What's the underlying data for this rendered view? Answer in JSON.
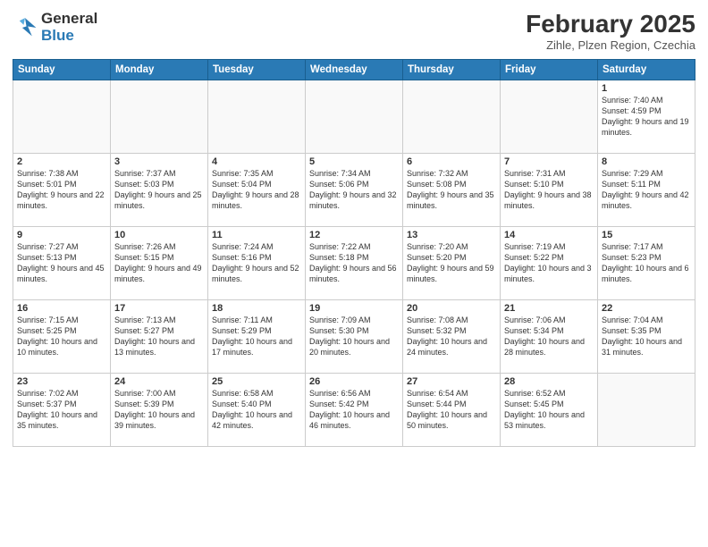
{
  "logo": {
    "general": "General",
    "blue": "Blue"
  },
  "title": "February 2025",
  "location": "Zihle, Plzen Region, Czechia",
  "days_of_week": [
    "Sunday",
    "Monday",
    "Tuesday",
    "Wednesday",
    "Thursday",
    "Friday",
    "Saturday"
  ],
  "weeks": [
    [
      {
        "num": "",
        "info": ""
      },
      {
        "num": "",
        "info": ""
      },
      {
        "num": "",
        "info": ""
      },
      {
        "num": "",
        "info": ""
      },
      {
        "num": "",
        "info": ""
      },
      {
        "num": "",
        "info": ""
      },
      {
        "num": "1",
        "info": "Sunrise: 7:40 AM\nSunset: 4:59 PM\nDaylight: 9 hours and 19 minutes."
      }
    ],
    [
      {
        "num": "2",
        "info": "Sunrise: 7:38 AM\nSunset: 5:01 PM\nDaylight: 9 hours and 22 minutes."
      },
      {
        "num": "3",
        "info": "Sunrise: 7:37 AM\nSunset: 5:03 PM\nDaylight: 9 hours and 25 minutes."
      },
      {
        "num": "4",
        "info": "Sunrise: 7:35 AM\nSunset: 5:04 PM\nDaylight: 9 hours and 28 minutes."
      },
      {
        "num": "5",
        "info": "Sunrise: 7:34 AM\nSunset: 5:06 PM\nDaylight: 9 hours and 32 minutes."
      },
      {
        "num": "6",
        "info": "Sunrise: 7:32 AM\nSunset: 5:08 PM\nDaylight: 9 hours and 35 minutes."
      },
      {
        "num": "7",
        "info": "Sunrise: 7:31 AM\nSunset: 5:10 PM\nDaylight: 9 hours and 38 minutes."
      },
      {
        "num": "8",
        "info": "Sunrise: 7:29 AM\nSunset: 5:11 PM\nDaylight: 9 hours and 42 minutes."
      }
    ],
    [
      {
        "num": "9",
        "info": "Sunrise: 7:27 AM\nSunset: 5:13 PM\nDaylight: 9 hours and 45 minutes."
      },
      {
        "num": "10",
        "info": "Sunrise: 7:26 AM\nSunset: 5:15 PM\nDaylight: 9 hours and 49 minutes."
      },
      {
        "num": "11",
        "info": "Sunrise: 7:24 AM\nSunset: 5:16 PM\nDaylight: 9 hours and 52 minutes."
      },
      {
        "num": "12",
        "info": "Sunrise: 7:22 AM\nSunset: 5:18 PM\nDaylight: 9 hours and 56 minutes."
      },
      {
        "num": "13",
        "info": "Sunrise: 7:20 AM\nSunset: 5:20 PM\nDaylight: 9 hours and 59 minutes."
      },
      {
        "num": "14",
        "info": "Sunrise: 7:19 AM\nSunset: 5:22 PM\nDaylight: 10 hours and 3 minutes."
      },
      {
        "num": "15",
        "info": "Sunrise: 7:17 AM\nSunset: 5:23 PM\nDaylight: 10 hours and 6 minutes."
      }
    ],
    [
      {
        "num": "16",
        "info": "Sunrise: 7:15 AM\nSunset: 5:25 PM\nDaylight: 10 hours and 10 minutes."
      },
      {
        "num": "17",
        "info": "Sunrise: 7:13 AM\nSunset: 5:27 PM\nDaylight: 10 hours and 13 minutes."
      },
      {
        "num": "18",
        "info": "Sunrise: 7:11 AM\nSunset: 5:29 PM\nDaylight: 10 hours and 17 minutes."
      },
      {
        "num": "19",
        "info": "Sunrise: 7:09 AM\nSunset: 5:30 PM\nDaylight: 10 hours and 20 minutes."
      },
      {
        "num": "20",
        "info": "Sunrise: 7:08 AM\nSunset: 5:32 PM\nDaylight: 10 hours and 24 minutes."
      },
      {
        "num": "21",
        "info": "Sunrise: 7:06 AM\nSunset: 5:34 PM\nDaylight: 10 hours and 28 minutes."
      },
      {
        "num": "22",
        "info": "Sunrise: 7:04 AM\nSunset: 5:35 PM\nDaylight: 10 hours and 31 minutes."
      }
    ],
    [
      {
        "num": "23",
        "info": "Sunrise: 7:02 AM\nSunset: 5:37 PM\nDaylight: 10 hours and 35 minutes."
      },
      {
        "num": "24",
        "info": "Sunrise: 7:00 AM\nSunset: 5:39 PM\nDaylight: 10 hours and 39 minutes."
      },
      {
        "num": "25",
        "info": "Sunrise: 6:58 AM\nSunset: 5:40 PM\nDaylight: 10 hours and 42 minutes."
      },
      {
        "num": "26",
        "info": "Sunrise: 6:56 AM\nSunset: 5:42 PM\nDaylight: 10 hours and 46 minutes."
      },
      {
        "num": "27",
        "info": "Sunrise: 6:54 AM\nSunset: 5:44 PM\nDaylight: 10 hours and 50 minutes."
      },
      {
        "num": "28",
        "info": "Sunrise: 6:52 AM\nSunset: 5:45 PM\nDaylight: 10 hours and 53 minutes."
      },
      {
        "num": "",
        "info": ""
      }
    ]
  ]
}
